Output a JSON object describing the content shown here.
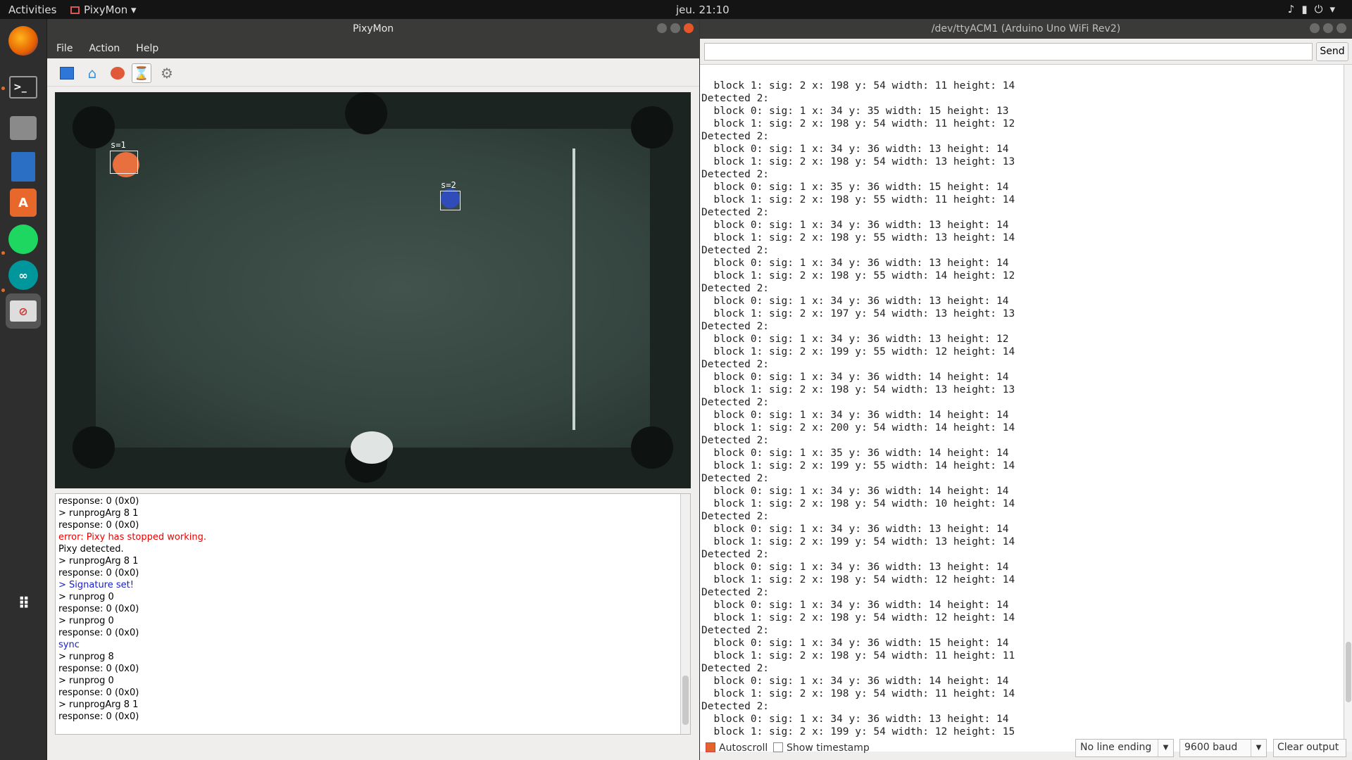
{
  "topbar": {
    "activities": "Activities",
    "app_name": "PixyMon",
    "clock": "jeu. 21:10"
  },
  "pixymon": {
    "title": "PixyMon",
    "menu": [
      "File",
      "Action",
      "Help"
    ],
    "signatures": [
      "s=1",
      "s=2"
    ],
    "console": [
      {
        "t": "response: 0 (0x0)",
        "c": ""
      },
      {
        "t": "> runprogArg 8 1",
        "c": ""
      },
      {
        "t": "response: 0 (0x0)",
        "c": ""
      },
      {
        "t": "error: Pixy has stopped working.",
        "c": "err"
      },
      {
        "t": "Pixy detected.",
        "c": ""
      },
      {
        "t": "> runprogArg 8 1",
        "c": ""
      },
      {
        "t": "response: 0 (0x0)",
        "c": ""
      },
      {
        "t": "> Signature set!",
        "c": "blu"
      },
      {
        "t": "> runprog 0",
        "c": ""
      },
      {
        "t": "response: 0 (0x0)",
        "c": ""
      },
      {
        "t": "> runprog 0",
        "c": ""
      },
      {
        "t": "response: 0 (0x0)",
        "c": ""
      },
      {
        "t": "sync",
        "c": "blu"
      },
      {
        "t": "> runprog 8",
        "c": ""
      },
      {
        "t": "response: 0 (0x0)",
        "c": ""
      },
      {
        "t": "> runprog 0",
        "c": ""
      },
      {
        "t": "response: 0 (0x0)",
        "c": ""
      },
      {
        "t": "> runprogArg 8 1",
        "c": ""
      },
      {
        "t": "response: 0 (0x0)",
        "c": ""
      }
    ]
  },
  "serial": {
    "title": "/dev/ttyACM1 (Arduino Uno WiFi Rev2)",
    "send_label": "Send",
    "lines": [
      "  block 1: sig: 2 x: 198 y: 54 width: 11 height: 14",
      "Detected 2:",
      "  block 0: sig: 1 x: 34 y: 35 width: 15 height: 13",
      "  block 1: sig: 2 x: 198 y: 54 width: 11 height: 12",
      "Detected 2:",
      "  block 0: sig: 1 x: 34 y: 36 width: 13 height: 14",
      "  block 1: sig: 2 x: 198 y: 54 width: 13 height: 13",
      "Detected 2:",
      "  block 0: sig: 1 x: 35 y: 36 width: 15 height: 14",
      "  block 1: sig: 2 x: 198 y: 55 width: 11 height: 14",
      "Detected 2:",
      "  block 0: sig: 1 x: 34 y: 36 width: 13 height: 14",
      "  block 1: sig: 2 x: 198 y: 55 width: 13 height: 14",
      "Detected 2:",
      "  block 0: sig: 1 x: 34 y: 36 width: 13 height: 14",
      "  block 1: sig: 2 x: 198 y: 55 width: 14 height: 12",
      "Detected 2:",
      "  block 0: sig: 1 x: 34 y: 36 width: 13 height: 14",
      "  block 1: sig: 2 x: 197 y: 54 width: 13 height: 13",
      "Detected 2:",
      "  block 0: sig: 1 x: 34 y: 36 width: 13 height: 12",
      "  block 1: sig: 2 x: 199 y: 55 width: 12 height: 14",
      "Detected 2:",
      "  block 0: sig: 1 x: 34 y: 36 width: 14 height: 14",
      "  block 1: sig: 2 x: 198 y: 54 width: 13 height: 13",
      "Detected 2:",
      "  block 0: sig: 1 x: 34 y: 36 width: 14 height: 14",
      "  block 1: sig: 2 x: 200 y: 54 width: 14 height: 14",
      "Detected 2:",
      "  block 0: sig: 1 x: 35 y: 36 width: 14 height: 14",
      "  block 1: sig: 2 x: 199 y: 55 width: 14 height: 14",
      "Detected 2:",
      "  block 0: sig: 1 x: 34 y: 36 width: 14 height: 14",
      "  block 1: sig: 2 x: 198 y: 54 width: 10 height: 14",
      "Detected 2:",
      "  block 0: sig: 1 x: 34 y: 36 width: 13 height: 14",
      "  block 1: sig: 2 x: 199 y: 54 width: 13 height: 14",
      "Detected 2:",
      "  block 0: sig: 1 x: 34 y: 36 width: 13 height: 14",
      "  block 1: sig: 2 x: 198 y: 54 width: 12 height: 14",
      "Detected 2:",
      "  block 0: sig: 1 x: 34 y: 36 width: 14 height: 14",
      "  block 1: sig: 2 x: 198 y: 54 width: 12 height: 14",
      "Detected 2:",
      "  block 0: sig: 1 x: 34 y: 36 width: 15 height: 14",
      "  block 1: sig: 2 x: 198 y: 54 width: 11 height: 11",
      "Detected 2:",
      "  block 0: sig: 1 x: 34 y: 36 width: 14 height: 14",
      "  block 1: sig: 2 x: 198 y: 54 width: 11 height: 14",
      "Detected 2:",
      "  block 0: sig: 1 x: 34 y: 36 width: 13 height: 14",
      "  block 1: sig: 2 x: 199 y: 54 width: 12 height: 15"
    ],
    "autoscroll_label": "Autoscroll",
    "timestamp_label": "Show timestamp",
    "line_ending": "No line ending",
    "baud": "9600 baud",
    "clear_label": "Clear output"
  }
}
